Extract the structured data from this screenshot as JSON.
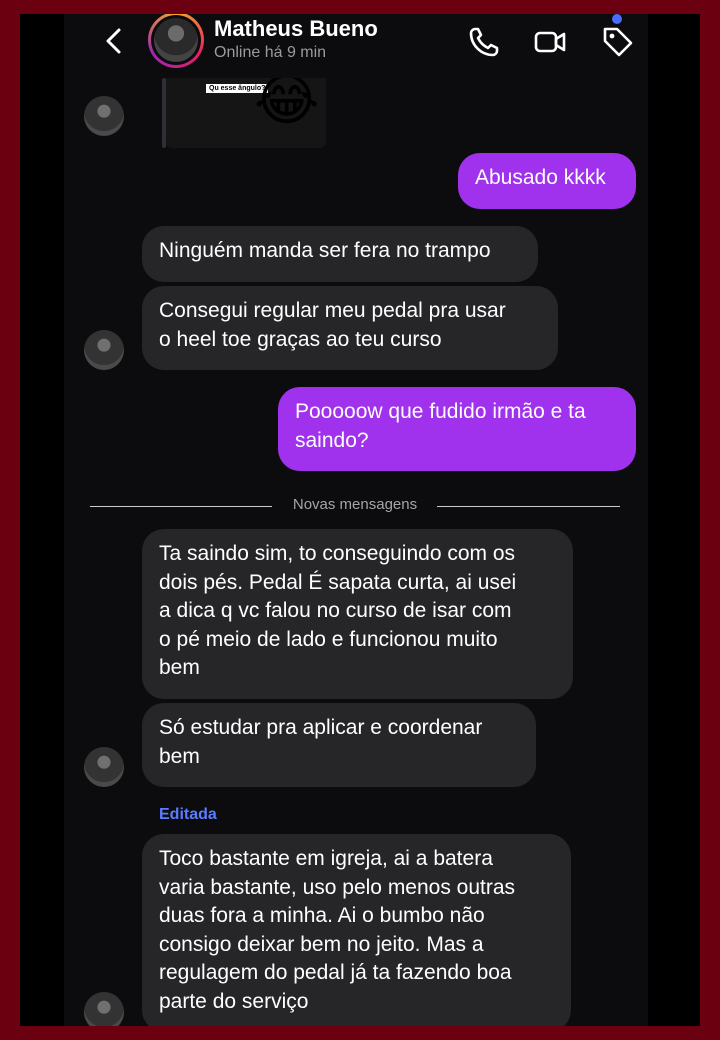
{
  "header": {
    "contact_name": "Matheus Bueno",
    "status": "Online há 9 min",
    "icons": [
      "back-icon",
      "phone-icon",
      "video-icon",
      "tag-icon"
    ]
  },
  "media": {
    "label": "Qu esse ângulo?",
    "emoji": "😂"
  },
  "messages": [
    {
      "from": "me",
      "text": "Abusado kkkk"
    },
    {
      "from": "contact",
      "text": "Ninguém manda ser fera no trampo"
    },
    {
      "from": "contact",
      "text": "Consegui regular meu pedal pra usar\no heel toe graças ao teu curso"
    },
    {
      "from": "me",
      "text": "Pooooow que fudido irmão e ta\nsaindo?"
    },
    {
      "from": "contact",
      "text": "Ta saindo sim, to conseguindo com os\ndois pés. Pedal É sapata curta, ai usei\na dica q vc falou no curso de isar com\no pé meio de lado e funcionou muito\nbem"
    },
    {
      "from": "contact",
      "text": "Só estudar pra aplicar e coordenar\nbem"
    },
    {
      "from": "contact",
      "text": "Toco bastante em igreja, ai a batera\nvaria bastante, uso pelo menos outras\nduas fora a minha. Ai o bumbo não\nconsigo deixar bem no jeito. Mas a\nregulagem do pedal já ta fazendo boa\nparte do serviço"
    }
  ],
  "divider_label": "Novas mensagens",
  "edited_label": "Editada",
  "colors": {
    "outgoing_bubble": "#a031ec",
    "incoming_bubble": "#262629",
    "background": "#0c0c0f",
    "frame": "#6b0011",
    "notification_dot": "#4a6cff",
    "edited_label": "#5b7cff"
  }
}
